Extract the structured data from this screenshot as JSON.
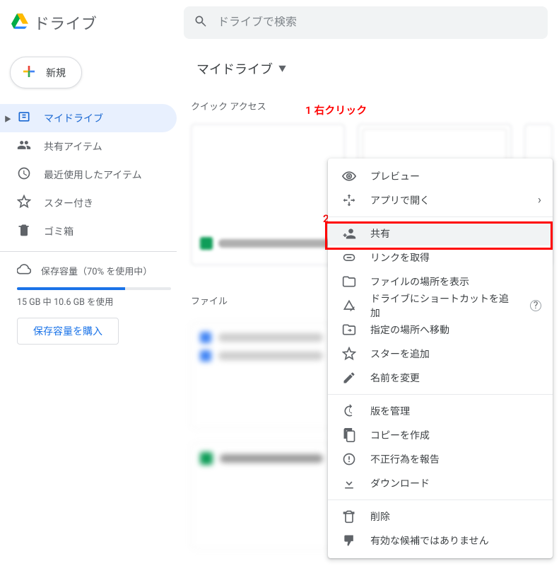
{
  "header": {
    "app_name": "ドライブ",
    "search_placeholder": "ドライブで検索"
  },
  "sidebar": {
    "new_label": "新規",
    "items": [
      {
        "id": "my-drive",
        "label": "マイドライブ",
        "icon": "drive-icon",
        "active": true
      },
      {
        "id": "shared",
        "label": "共有アイテム",
        "icon": "people-icon"
      },
      {
        "id": "recent",
        "label": "最近使用したアイテム",
        "icon": "clock-icon"
      },
      {
        "id": "starred",
        "label": "スター付き",
        "icon": "star-icon"
      },
      {
        "id": "trash",
        "label": "ゴミ箱",
        "icon": "trash-icon"
      }
    ],
    "storage": {
      "label": "保存容量（70% を使用中）",
      "percent": 70,
      "detail": "15 GB 中 10.6 GB を使用",
      "buy_label": "保存容量を購入"
    }
  },
  "main": {
    "breadcrumb": "マイドライブ",
    "quick_access_label": "クイック アクセス",
    "files_label": "ファイル"
  },
  "annotations": {
    "a1": "1 右クリック",
    "a2": "2"
  },
  "context_menu": {
    "groups": [
      [
        {
          "id": "preview",
          "label": "プレビュー",
          "icon": "eye-icon"
        },
        {
          "id": "open-with",
          "label": "アプリで開く",
          "icon": "open-with-icon",
          "submenu": true
        }
      ],
      [
        {
          "id": "share",
          "label": "共有",
          "icon": "person-add-icon"
        },
        {
          "id": "get-link",
          "label": "リンクを取得",
          "icon": "link-icon"
        },
        {
          "id": "show-location",
          "label": "ファイルの場所を表示",
          "icon": "folder-icon"
        },
        {
          "id": "add-shortcut",
          "label": "ドライブにショートカットを追加",
          "icon": "drive-shortcut-icon",
          "help": true
        },
        {
          "id": "move-to",
          "label": "指定の場所へ移動",
          "icon": "move-icon"
        },
        {
          "id": "add-star",
          "label": "スターを追加",
          "icon": "star-icon"
        },
        {
          "id": "rename",
          "label": "名前を変更",
          "icon": "rename-icon"
        }
      ],
      [
        {
          "id": "manage-versions",
          "label": "版を管理",
          "icon": "history-icon"
        },
        {
          "id": "make-copy",
          "label": "コピーを作成",
          "icon": "copy-icon"
        },
        {
          "id": "report-abuse",
          "label": "不正行為を報告",
          "icon": "report-icon"
        },
        {
          "id": "download",
          "label": "ダウンロード",
          "icon": "download-icon"
        }
      ],
      [
        {
          "id": "remove",
          "label": "削除",
          "icon": "trash-icon"
        },
        {
          "id": "not-suggestion",
          "label": "有効な候補ではありません",
          "icon": "thumbs-down-icon"
        }
      ]
    ]
  }
}
